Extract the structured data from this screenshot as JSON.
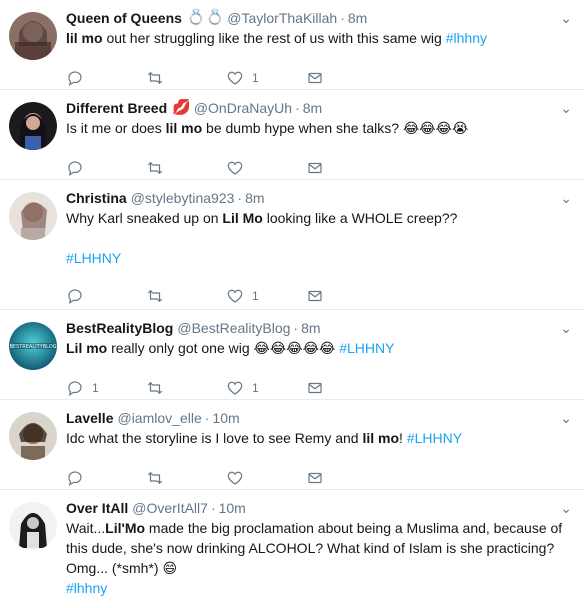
{
  "tweets": [
    {
      "name": "Queen of Queens",
      "name_emoji": "💍💍",
      "handle": "@TaylorThaKillah",
      "time": "8m",
      "parts": [
        {
          "b": "lil mo"
        },
        {
          "t": " out her struggling like the rest of us with this same wig "
        },
        {
          "h": "#lhhny"
        }
      ],
      "reply": "",
      "retweet": "",
      "like": "1"
    },
    {
      "name": "Different Breed",
      "name_emoji": "💋",
      "handle": "@OnDraNayUh",
      "time": "8m",
      "parts": [
        {
          "t": "Is it me or does "
        },
        {
          "b": "lil mo"
        },
        {
          "t": " be dumb hype when she talks? "
        },
        {
          "e": "😂😂😂😭"
        }
      ],
      "reply": "",
      "retweet": "",
      "like": ""
    },
    {
      "name": "Christina",
      "name_emoji": "",
      "handle": "@stylebytina923",
      "time": "8m",
      "parts": [
        {
          "t": "Why Karl sneaked up on "
        },
        {
          "b": "Lil Mo"
        },
        {
          "t": " looking like a WHOLE creep??"
        }
      ],
      "extra": "#LHHNY",
      "reply": "",
      "retweet": "",
      "like": "1"
    },
    {
      "name": "BestRealityBlog",
      "name_emoji": "",
      "handle": "@BestRealityBlog",
      "time": "8m",
      "parts": [
        {
          "b": "Lil mo"
        },
        {
          "t": " really only got one wig "
        },
        {
          "e": "😂😂😂😂😂"
        },
        {
          "t": " "
        },
        {
          "h": "#LHHNY"
        }
      ],
      "reply": "1",
      "retweet": "",
      "like": "1"
    },
    {
      "name": "Lavelle",
      "name_emoji": "",
      "handle": "@iamlov_elle",
      "time": "10m",
      "parts": [
        {
          "t": "Idc what the storyline is I love to see Remy and "
        },
        {
          "b": "lil mo"
        },
        {
          "t": "! "
        },
        {
          "h": "#LHHNY"
        }
      ],
      "reply": "",
      "retweet": "",
      "like": ""
    },
    {
      "name": "Over ItAll",
      "name_emoji": "",
      "handle": "@OverItAll7",
      "time": "10m",
      "parts": [
        {
          "t": "Wait..."
        },
        {
          "b": "Lil'Mo"
        },
        {
          "t": " made the big proclamation about being a Muslima and, because of this dude, she's now drinking ALCOHOL? What kind of Islam is she practicing? Omg... (*smh*) "
        },
        {
          "e": "😄"
        }
      ],
      "extra": "#lhhny",
      "reply": "",
      "retweet": "",
      "like": ""
    }
  ],
  "colors": {
    "link": "#1da1f2",
    "muted": "#657786",
    "border": "#e6ecf0"
  },
  "icons": [
    "reply-icon",
    "retweet-icon",
    "like-icon",
    "message-icon",
    "chevron-down-icon"
  ]
}
